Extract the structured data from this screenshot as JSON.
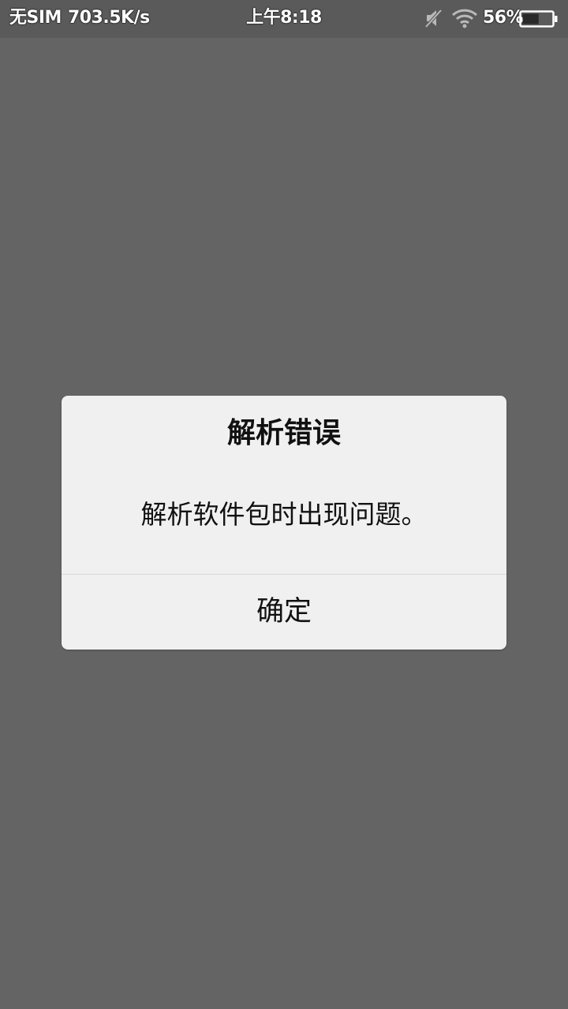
{
  "status_bar": {
    "sim": "无SIM",
    "speed": "703.5K/s",
    "time": "上午8:18",
    "battery_percent": "56%",
    "battery_level": 0.56,
    "icons": [
      "mute-icon",
      "wifi-icon",
      "battery-icon"
    ]
  },
  "dialog": {
    "title": "解析错误",
    "message": "解析软件包时出现问题。",
    "confirm_label": "确定"
  },
  "colors": {
    "background": "#646464",
    "dialog_background": "#f0f0f0",
    "text": "#111111"
  }
}
